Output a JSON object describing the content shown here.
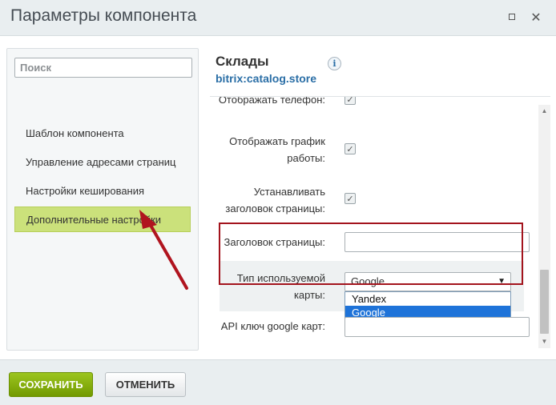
{
  "window": {
    "title": "Параметры компонента",
    "maximize_icon": "maximize-icon",
    "close_icon": "close-icon",
    "close_glyph": "✕"
  },
  "sidebar": {
    "search_placeholder": "Поиск",
    "items": [
      {
        "label": "Шаблон компонента",
        "active": false
      },
      {
        "label": "Управление адресами страниц",
        "active": false
      },
      {
        "label": "Настройки кеширования",
        "active": false
      },
      {
        "label": "Дополнительные настройки",
        "active": true
      }
    ]
  },
  "component": {
    "title": "Склады",
    "code": "bitrix:catalog.store",
    "info_glyph": "i"
  },
  "params": {
    "show_phone": {
      "label": "Отображать телефон:",
      "checked": true
    },
    "show_schedule": {
      "label_line1": "Отображать график",
      "label_line2": "работы:",
      "checked": true
    },
    "set_title": {
      "label_line1": "Устанавливать",
      "label_line2": "заголовок страницы:",
      "checked": true
    },
    "page_title": {
      "label": "Заголовок страницы:",
      "value": ""
    },
    "map_type": {
      "label_line1": "Тип используемой",
      "label_line2": "карты:",
      "selected": "Google",
      "options": [
        "Yandex",
        "Google"
      ],
      "arrow": "▼"
    },
    "api_key": {
      "label": "API ключ google карт:",
      "value": ""
    }
  },
  "checkbox_glyph": "✓",
  "footer": {
    "save_label": "СОХРАНИТЬ",
    "cancel_label": "ОТМЕНИТЬ"
  },
  "colors": {
    "accent_green": "#86ad00",
    "active_item": "#cbe17b",
    "highlight_border": "#a3141d",
    "arrow": "#b0141f",
    "link_blue": "#2a6ea6",
    "dropdown_selected": "#1e73d9"
  }
}
